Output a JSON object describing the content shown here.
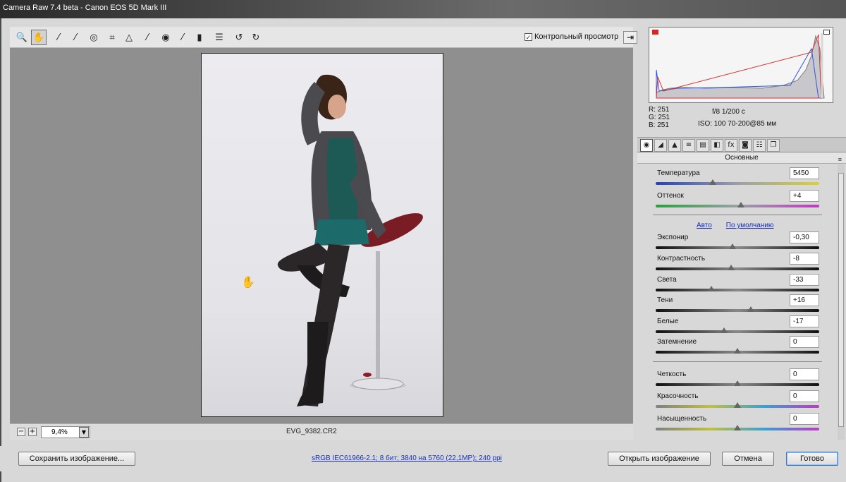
{
  "window": {
    "title": "Camera Raw 7.4 beta  -  Canon EOS 5D Mark III"
  },
  "toolbar": {
    "tools": [
      {
        "name": "zoom-tool-icon",
        "glyph": "🔍"
      },
      {
        "name": "hand-tool-icon",
        "glyph": "✋"
      },
      {
        "name": "white-balance-tool-icon",
        "glyph": "⁄"
      },
      {
        "name": "color-sampler-tool-icon",
        "glyph": "⁄"
      },
      {
        "name": "targeted-adjustment-tool-icon",
        "glyph": "◎"
      },
      {
        "name": "crop-tool-icon",
        "glyph": "⌗"
      },
      {
        "name": "straighten-tool-icon",
        "glyph": "△"
      },
      {
        "name": "spot-removal-tool-icon",
        "glyph": "⁄"
      },
      {
        "name": "red-eye-tool-icon",
        "glyph": "◉"
      },
      {
        "name": "adjustment-brush-icon",
        "glyph": "⁄"
      },
      {
        "name": "graduated-filter-icon",
        "glyph": "▮"
      },
      {
        "name": "preferences-icon",
        "glyph": "☰"
      },
      {
        "name": "rotate-left-icon",
        "glyph": "↺"
      },
      {
        "name": "rotate-right-icon",
        "glyph": "↻"
      }
    ],
    "preview_label": "Контрольный просмотр",
    "preview_checked": "✓",
    "fullscreen_glyph": "⇥"
  },
  "canvas": {
    "zoom_value": "9,4%",
    "zoom_minus": "−",
    "zoom_plus": "+",
    "zoom_drop": "▼",
    "filename": "EVG_9382.CR2",
    "cursor_glyph": "✋"
  },
  "info": {
    "r": "R:  251",
    "g": "G:  251",
    "b": "B:  251",
    "exif_line1": "f/8    1/200 с",
    "exif_line2": "ISO: 100    70-200@85 мм"
  },
  "tabs": [
    {
      "name": "tab-basic",
      "glyph": "◉"
    },
    {
      "name": "tab-tone-curve",
      "glyph": "◢"
    },
    {
      "name": "tab-detail",
      "glyph": "▲"
    },
    {
      "name": "tab-hsl",
      "glyph": "≡"
    },
    {
      "name": "tab-split-toning",
      "glyph": "▤"
    },
    {
      "name": "tab-lens-corrections",
      "glyph": "◧"
    },
    {
      "name": "tab-effects",
      "glyph": "fx"
    },
    {
      "name": "tab-camera-calibration",
      "glyph": "◙"
    },
    {
      "name": "tab-presets",
      "glyph": "☷"
    },
    {
      "name": "tab-snapshots",
      "glyph": "❐"
    }
  ],
  "panel": {
    "section_title": "Основные",
    "menu_glyph": "≡",
    "auto_link": "Авто",
    "default_link": "По умолчанию",
    "sliders": [
      {
        "name": "temperature",
        "label": "Температура",
        "value": "5450",
        "position": 0.35,
        "track": "temp"
      },
      {
        "name": "tint",
        "label": "Оттенок",
        "value": "+4",
        "position": 0.52,
        "track": "tint"
      },
      {
        "name": "exposure",
        "label": "Экспонир",
        "value": "-0,30",
        "position": 0.47,
        "track": "gray"
      },
      {
        "name": "contrast",
        "label": "Контрастность",
        "value": "-8",
        "position": 0.46,
        "track": "gray"
      },
      {
        "name": "highlights",
        "label": "Света",
        "value": "-33",
        "position": 0.34,
        "track": "gray"
      },
      {
        "name": "shadows",
        "label": "Тени",
        "value": "+16",
        "position": 0.58,
        "track": "gray"
      },
      {
        "name": "whites",
        "label": "Белые",
        "value": "-17",
        "position": 0.42,
        "track": "gray"
      },
      {
        "name": "blacks",
        "label": "Затемнение",
        "value": "0",
        "position": 0.5,
        "track": "gray"
      },
      {
        "name": "clarity",
        "label": "Четкость",
        "value": "0",
        "position": 0.5,
        "track": "gray"
      },
      {
        "name": "vibrance",
        "label": "Красочность",
        "value": "0",
        "position": 0.5,
        "track": "sat"
      },
      {
        "name": "saturation",
        "label": "Насыщенность",
        "value": "0",
        "position": 0.5,
        "track": "sat"
      }
    ]
  },
  "footer": {
    "save_label": "Сохранить изображение...",
    "workflow_info": "sRGB IEC61966-2.1; 8 бит; 3840 на 5760 (22,1MP); 240 ppi",
    "open_label": "Открыть изображение",
    "cancel_label": "Отмена",
    "done_label": "Готово"
  }
}
